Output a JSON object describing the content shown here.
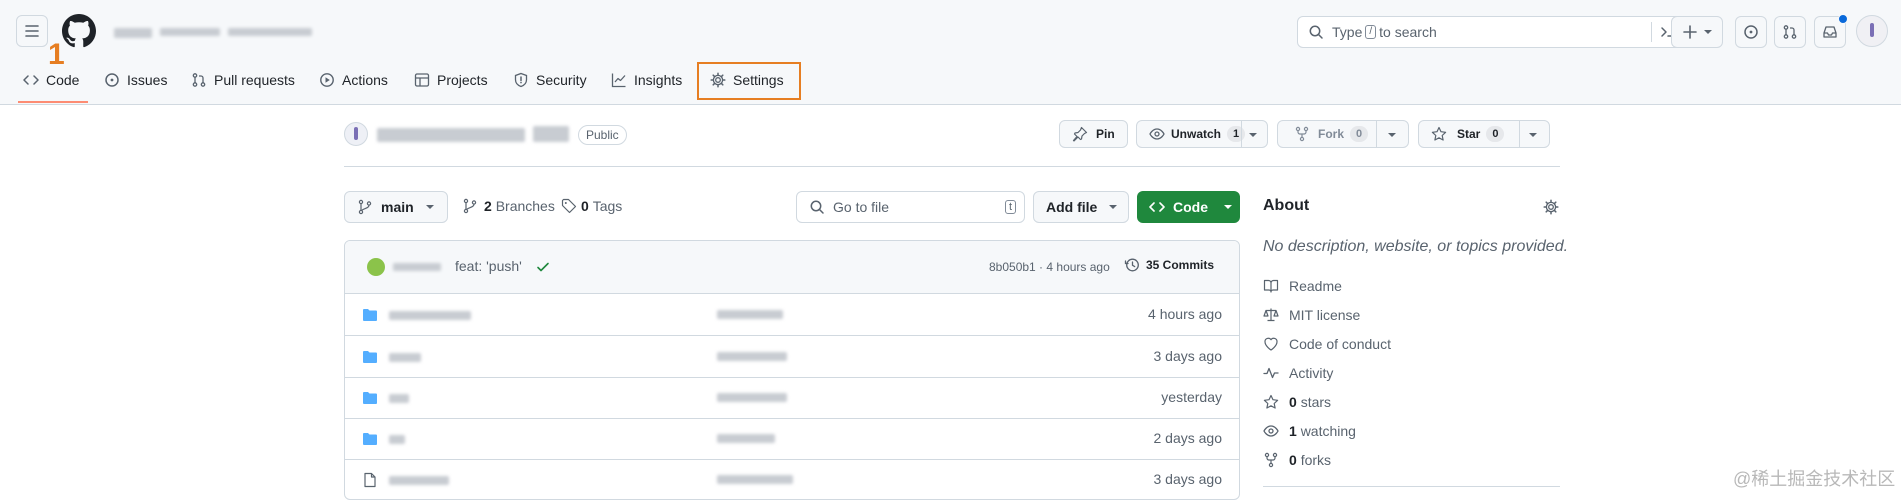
{
  "annotation": {
    "marker": "1"
  },
  "header": {
    "search_placeholder_before": "Type",
    "search_key": "/",
    "search_placeholder_after": "to search"
  },
  "tabs": [
    {
      "label": "Code"
    },
    {
      "label": "Issues"
    },
    {
      "label": "Pull requests"
    },
    {
      "label": "Actions"
    },
    {
      "label": "Projects"
    },
    {
      "label": "Security"
    },
    {
      "label": "Insights"
    },
    {
      "label": "Settings"
    }
  ],
  "repo": {
    "visibility": "Public",
    "pin_label": "Pin",
    "unwatch_label": "Unwatch",
    "unwatch_count": "1",
    "fork_label": "Fork",
    "fork_count": "0",
    "star_label": "Star",
    "star_count": "0"
  },
  "toolbar": {
    "branch": "main",
    "branches_count": "2",
    "branches_label": "Branches",
    "tags_count": "0",
    "tags_label": "Tags",
    "goto_placeholder": "Go to file",
    "goto_key": "t",
    "add_file_label": "Add file",
    "code_label": "Code"
  },
  "commit": {
    "message": "feat: 'push'",
    "hash_time": "8b050b1 · 4 hours ago",
    "commits_label": "35 Commits"
  },
  "files": [
    {
      "type": "folder",
      "time": "4 hours ago"
    },
    {
      "type": "folder",
      "time": "3 days ago"
    },
    {
      "type": "folder",
      "time": "yesterday"
    },
    {
      "type": "folder",
      "time": "2 days ago"
    },
    {
      "type": "file",
      "time": "3 days ago"
    }
  ],
  "about": {
    "title": "About",
    "description": "No description, website, or topics provided.",
    "items": [
      {
        "label": "Readme",
        "icon": "book-icon"
      },
      {
        "label": "MIT license",
        "icon": "law-icon"
      },
      {
        "label": "Code of conduct",
        "icon": "heart-icon"
      },
      {
        "label": "Activity",
        "icon": "pulse-icon"
      },
      {
        "count": "0",
        "label": "stars",
        "icon": "star-icon"
      },
      {
        "count": "1",
        "label": "watching",
        "icon": "eye-icon"
      },
      {
        "count": "0",
        "label": "forks",
        "icon": "fork-icon"
      }
    ]
  },
  "watermark": "@稀土掘金技术社区",
  "colors": {
    "accent_orange": "#e67e22",
    "code_green": "#1f883d",
    "tab_underline": "#fd8c73",
    "folder_blue": "#54aeff"
  }
}
